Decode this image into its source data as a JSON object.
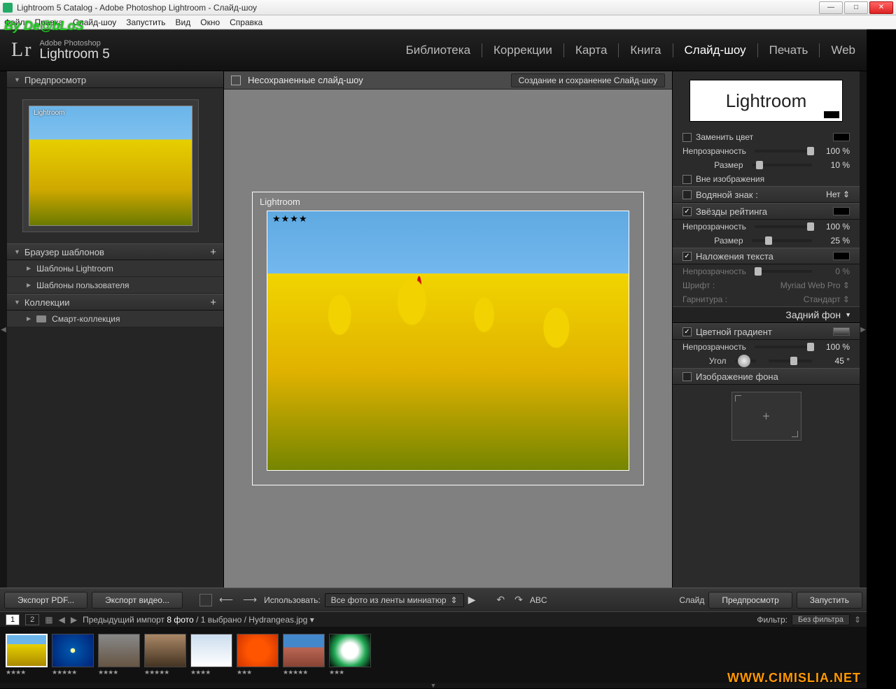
{
  "window": {
    "title": "Lightroom 5 Catalog - Adobe Photoshop Lightroom - Слайд-шоу"
  },
  "overlay": {
    "by": "By De@bLoS",
    "site": "WWW.CIMISLIA.NET"
  },
  "menubar": [
    "Файл",
    "Правка",
    "Слайд-шоу",
    "Запустить",
    "Вид",
    "Окно",
    "Справка"
  ],
  "logo": {
    "brand_small": "Adobe Photoshop",
    "brand_big": "Lightroom 5",
    "lr": "Lr"
  },
  "modules": [
    {
      "label": "Библиотека",
      "active": false
    },
    {
      "label": "Коррекции",
      "active": false
    },
    {
      "label": "Карта",
      "active": false
    },
    {
      "label": "Книга",
      "active": false
    },
    {
      "label": "Слайд-шоу",
      "active": true
    },
    {
      "label": "Печать",
      "active": false
    },
    {
      "label": "Web",
      "active": false
    }
  ],
  "left": {
    "preview_head": "Предпросмотр",
    "preview_label": "Lightroom",
    "tpl_head": "Браузер шаблонов",
    "tpl_items": [
      "Шаблоны Lightroom",
      "Шаблоны пользователя"
    ],
    "col_head": "Коллекции",
    "col_items": [
      "Смарт-коллекция"
    ]
  },
  "center": {
    "head": "Несохраненные слайд-шоу",
    "head_btn": "Создание и сохранение Слайд-шоу",
    "slide_label": "Lightroom",
    "slide_stars": "★★★★"
  },
  "right": {
    "identity": "Lightroom",
    "replace_color": "Заменить цвет",
    "opacity": "Непрозрачность",
    "opacity_val": "100 %",
    "size": "Размер",
    "size_val": "10 %",
    "outside": "Вне изображения",
    "watermark": "Водяной знак :",
    "watermark_val": "Нет ⇕",
    "rating": "Звёзды рейтинга",
    "rating_opacity_val": "100 %",
    "rating_size_val": "25 %",
    "textoverlay": "Наложения текста",
    "text_opacity_val": "0 %",
    "font_lab": "Шрифт :",
    "font_val": "Myriad Web Pro ⇕",
    "face_lab": "Гарнитура :",
    "face_val": "Стандарт ⇕",
    "section_bg": "Задний фон",
    "gradient": "Цветной градиент",
    "grad_opacity_val": "100 %",
    "angle_lab": "Угол",
    "angle_val": "45 °",
    "bgimage": "Изображение фона",
    "drop_plus": "+"
  },
  "toolbar": {
    "export_pdf": "Экспорт PDF...",
    "export_video": "Экспорт видео...",
    "use": "Использовать:",
    "use_sel": "Все фото из ленты миниатюр",
    "abc": "ABC",
    "slide": "Слайд",
    "preview": "Предпросмотр",
    "run": "Запустить"
  },
  "filmstriphead": {
    "pages": [
      "1",
      "2"
    ],
    "text_a": "Предыдущий импорт",
    "text_b": "8 фото",
    "text_c": "/ 1 выбрано /",
    "text_d": "Hydrangeas.jpg",
    "filter_lab": "Фильтр:",
    "filter_val": "Без фильтра"
  },
  "thumbs": [
    {
      "stars": "★★★★",
      "sel": true,
      "cls": "thumb1"
    },
    {
      "stars": "★★★★★",
      "sel": false,
      "cls": "thumb2"
    },
    {
      "stars": "★★★★",
      "sel": false,
      "cls": "thumb3"
    },
    {
      "stars": "★★★★★",
      "sel": false,
      "cls": "thumb4"
    },
    {
      "stars": "★★★★",
      "sel": false,
      "cls": "thumb5"
    },
    {
      "stars": "★★★",
      "sel": false,
      "cls": "thumb6"
    },
    {
      "stars": "★★★★★",
      "sel": false,
      "cls": "thumb7"
    },
    {
      "stars": "★★★",
      "sel": false,
      "cls": "thumb8"
    }
  ]
}
